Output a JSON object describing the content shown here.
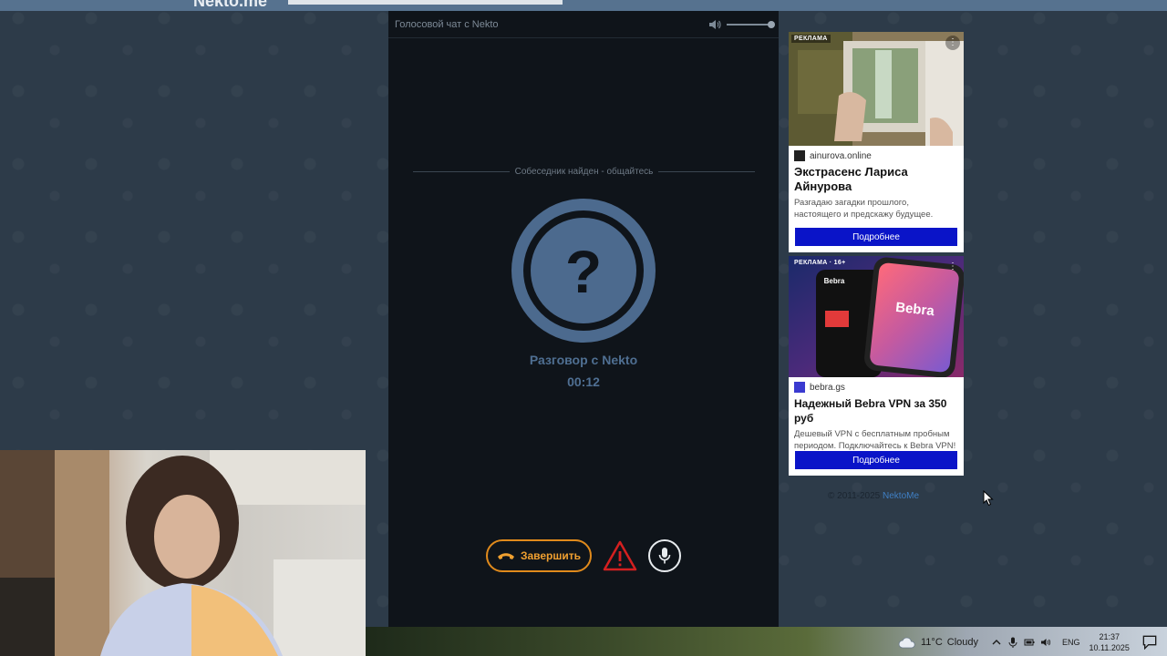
{
  "header": {
    "logo": "Nekto.me"
  },
  "chat": {
    "title": "Голосовой чат с Nekto",
    "status": "Собеседник найден - общайтесь",
    "avatar_symbol": "?",
    "conversation_title": "Разговор с Nekto",
    "timer": "00:12",
    "end_label": "Завершить",
    "colors": {
      "accent": "#4f6f92",
      "end": "#f0a030",
      "report": "#d42020"
    }
  },
  "ads": [
    {
      "label": "РЕКЛАМА",
      "domain": "ainurova.online",
      "title": "Экстрасенс Лариса Айнурова",
      "text": "Разгадаю загадки прошлого, настоящего и предскажу будущее.",
      "cta": "Подробнее"
    },
    {
      "label": "РЕКЛАМА · 16+",
      "domain": "bebra.gs",
      "title": "Надежный Bebra VPN за 350 руб",
      "text": "Дешевый VPN с бесплатным пробным периодом. Подключайтесь к Bebra VPN!",
      "cta": "Подробнее",
      "image_brand": "Bebra"
    }
  ],
  "footer": {
    "copyright": "© 2011-2025",
    "link": "NektoMe"
  },
  "taskbar": {
    "temperature": "11°C",
    "weather": "Cloudy",
    "language": "ENG",
    "time": "21:37",
    "date": "10.11.2025"
  }
}
